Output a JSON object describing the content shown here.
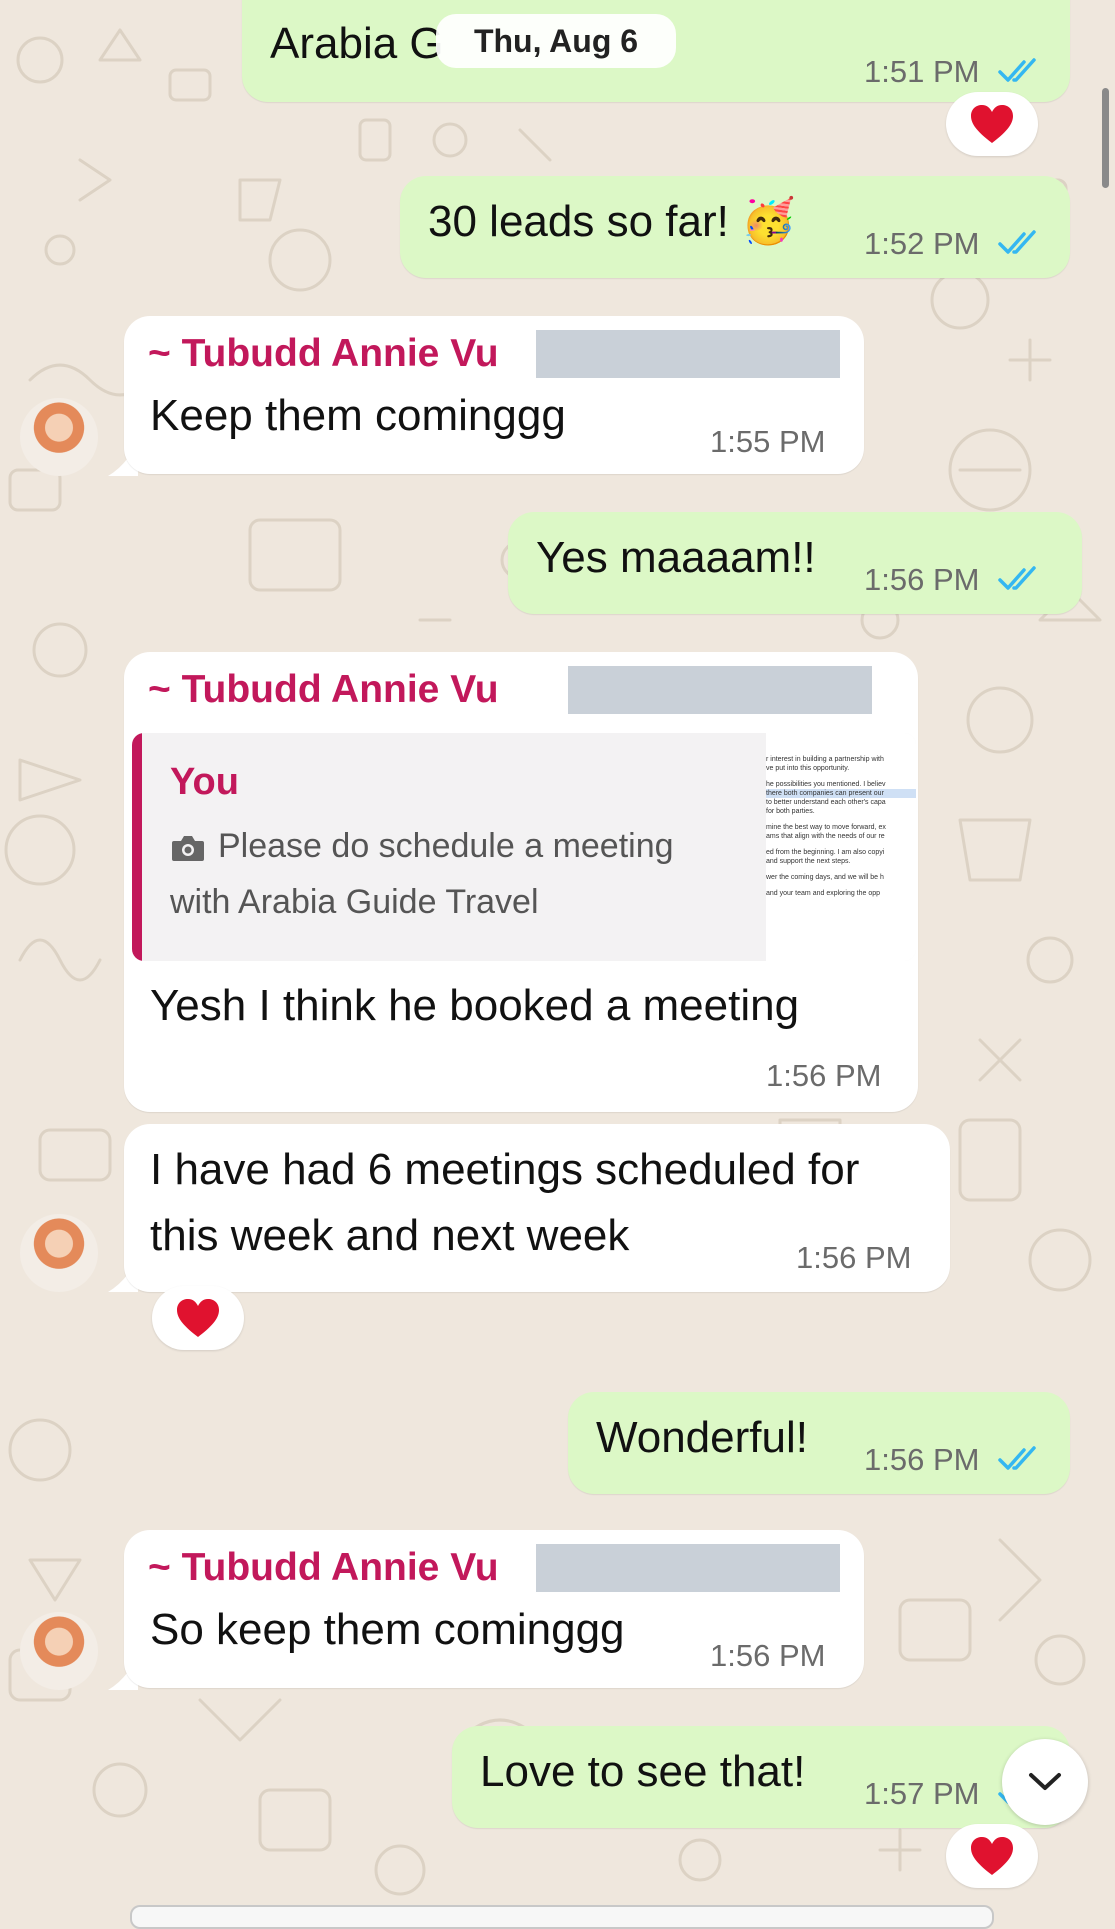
{
  "date_pill": "Thu, Aug 6",
  "messages": [
    {
      "text": "Arabia G",
      "time": "1:51 PM",
      "reaction": "heart"
    },
    {
      "text": "30 leads so far! 🥳",
      "time": "1:52 PM"
    },
    {
      "sender": "~ Tubudd Annie Vu",
      "text": "Keep them cominggg",
      "time": "1:55 PM"
    },
    {
      "text": "Yes maaaam!!",
      "time": "1:56 PM"
    },
    {
      "sender": "~ Tubudd Annie Vu",
      "quote": {
        "sender": "You",
        "line1": "Please do schedule a meeting",
        "line2": "with Arabia Guide Travel",
        "thumb_lines": [
          "r interest in building a partnership with",
          "ve put into this opportunity.",
          "he possibilities you mentioned. I believ",
          "there both companies can present our",
          "to better understand each other's capa",
          "for both parties.",
          "mine the best way to move forward, ex",
          "ams that align with the needs of our re",
          "ed from the beginning. I am also copyi",
          "and support the next steps.",
          "wer the coming days, and we will be h",
          "and your team and exploring the opp"
        ]
      },
      "text": "Yesh I think he booked a meeting",
      "time": "1:56 PM"
    },
    {
      "text_line1": "I have had 6 meetings scheduled for",
      "text_line2": "this week and next week",
      "time": "1:56 PM",
      "reaction": "heart"
    },
    {
      "text": "Wonderful!",
      "time": "1:56 PM"
    },
    {
      "sender": "~ Tubudd Annie Vu",
      "text": "So keep them cominggg",
      "time": "1:56 PM"
    },
    {
      "text": "Love to see that!",
      "time": "1:57 PM",
      "reaction": "heart"
    }
  ],
  "colors": {
    "outgoing": "#dcf8c6",
    "incoming": "#ffffff",
    "sender_name": "#c2185b",
    "read_ticks": "#34b7f1",
    "background": "#efe7dd"
  },
  "icons": [
    "camera-icon",
    "double-check-icon",
    "heart-icon",
    "chevron-down-icon",
    "avatar"
  ]
}
